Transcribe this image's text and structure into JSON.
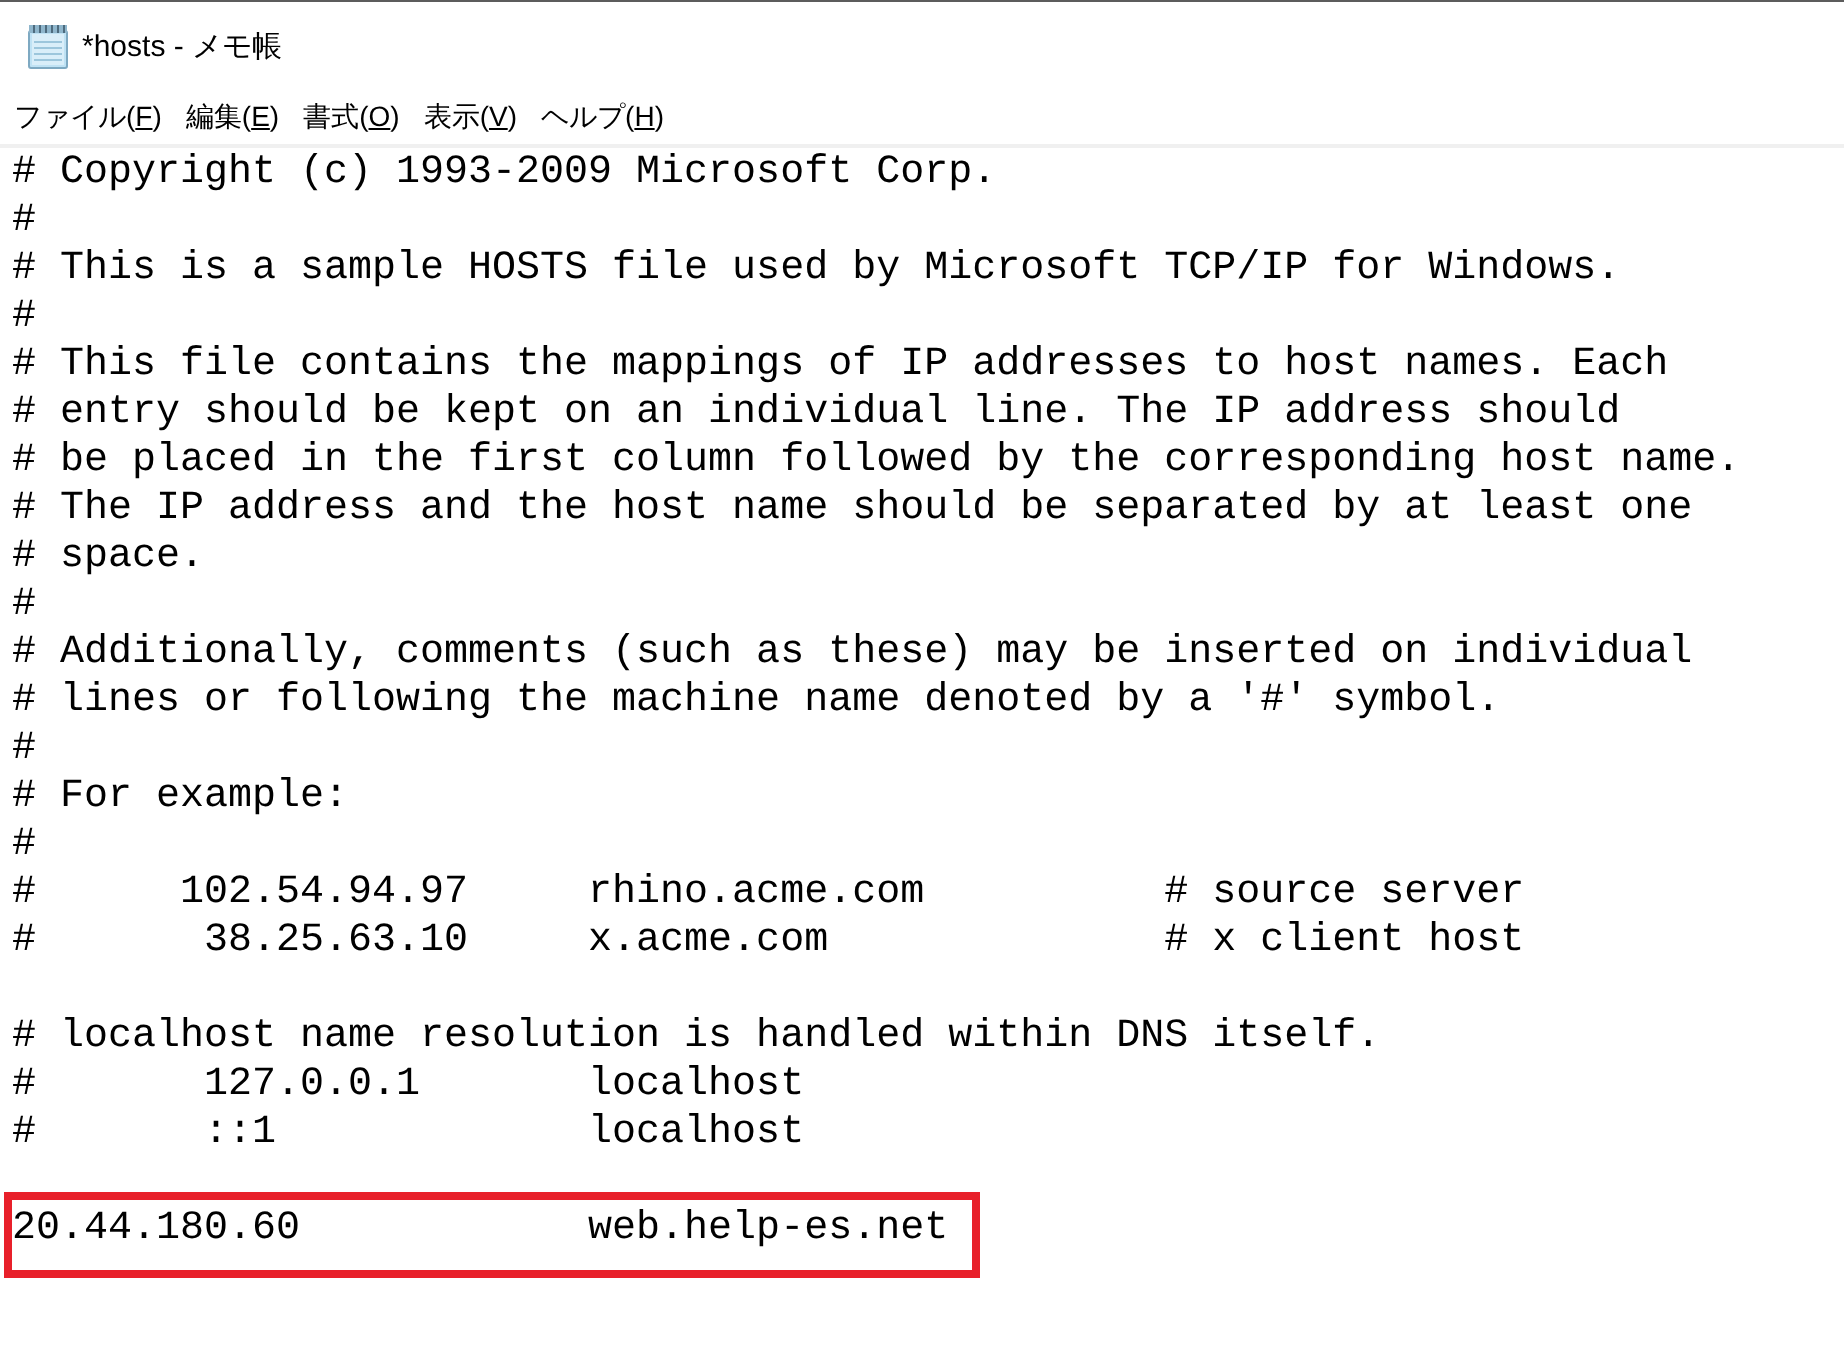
{
  "window": {
    "title": "*hosts - メモ帳"
  },
  "menu": [
    {
      "label": "ファイル(",
      "mnemonic": "F",
      "suffix": ")"
    },
    {
      "label": "編集(",
      "mnemonic": "E",
      "suffix": ")"
    },
    {
      "label": "書式(",
      "mnemonic": "O",
      "suffix": ")"
    },
    {
      "label": "表示(",
      "mnemonic": "V",
      "suffix": ")"
    },
    {
      "label": "ヘルプ(",
      "mnemonic": "H",
      "suffix": ")"
    }
  ],
  "editor": {
    "blocks": [
      {
        "highlighted": false,
        "lines": [
          "# Copyright (c) 1993-2009 Microsoft Corp.",
          "#",
          "# This is a sample HOSTS file used by Microsoft TCP/IP for Windows.",
          "#",
          "# This file contains the mappings of IP addresses to host names. Each",
          "# entry should be kept on an individual line. The IP address should",
          "# be placed in the first column followed by the corresponding host name.",
          "# The IP address and the host name should be separated by at least one",
          "# space.",
          "#",
          "# Additionally, comments (such as these) may be inserted on individual",
          "# lines or following the machine name denoted by a '#' symbol.",
          "#",
          "# For example:",
          "#",
          "#      102.54.94.97     rhino.acme.com          # source server",
          "#       38.25.63.10     x.acme.com              # x client host"
        ]
      },
      {
        "highlighted": false,
        "lines": [
          "# localhost name resolution is handled within DNS itself.",
          "#       127.0.0.1       localhost",
          "#       ::1             localhost"
        ]
      },
      {
        "highlighted": true,
        "lines": [
          "20.44.180.60            web.help-es.net"
        ]
      }
    ]
  }
}
